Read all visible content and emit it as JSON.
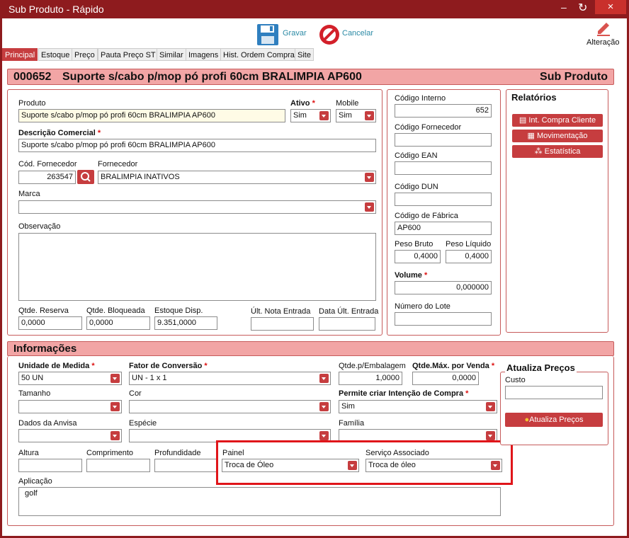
{
  "window": {
    "title": "Sub Produto - Rápido",
    "minimize": "–",
    "refresh": "↻",
    "close": "×"
  },
  "toolbar": {
    "gravar": "Gravar",
    "cancelar": "Cancelar",
    "alteracao": "Alteração"
  },
  "tabs": [
    "Principal",
    "Estoque",
    "Preço",
    "Pauta Preço ST",
    "Similar",
    "Imagens",
    "Hist. Ordem Compra",
    "Site"
  ],
  "header": {
    "code": "000652",
    "name": "Suporte s/cabo p/mop pó profi 60cm BRALIMPIA AP600",
    "type": "Sub Produto"
  },
  "produto": {
    "label": "Produto",
    "value": "Suporte s/cabo p/mop pó profi 60cm BRALIMPIA AP600"
  },
  "ativo": {
    "label": "Ativo",
    "value": "Sim"
  },
  "mobile": {
    "label": "Mobile",
    "value": "Sim"
  },
  "descricao": {
    "label": "Descrição Comercial",
    "value": "Suporte s/cabo p/mop pó profi 60cm BRALIMPIA AP600"
  },
  "cod_fornecedor": {
    "label": "Cód. Fornecedor",
    "value": "263547"
  },
  "fornecedor": {
    "label": "Fornecedor",
    "value": "BRALIMPIA INATIVOS"
  },
  "marca": {
    "label": "Marca",
    "value": ""
  },
  "observacao": {
    "label": "Observação",
    "value": ""
  },
  "qtde_reserva": {
    "label": "Qtde. Reserva",
    "value": "0,0000"
  },
  "qtde_bloqueada": {
    "label": "Qtde. Bloqueada",
    "value": "0,0000"
  },
  "estoque_disp": {
    "label": "Estoque Disp.",
    "value": "9.351,0000"
  },
  "ult_nota": {
    "label": "Últ. Nota Entrada",
    "value": ""
  },
  "data_ult": {
    "label": "Data Últ. Entrada",
    "value": ""
  },
  "codigo_interno": {
    "label": "Código Interno",
    "value": "652"
  },
  "codigo_fornecedor": {
    "label": "Código Fornecedor",
    "value": ""
  },
  "codigo_ean": {
    "label": "Código EAN",
    "value": ""
  },
  "codigo_dun": {
    "label": "Código DUN",
    "value": ""
  },
  "codigo_fabrica": {
    "label": "Código de Fábrica",
    "value": "AP600"
  },
  "peso_bruto": {
    "label": "Peso Bruto",
    "value": "0,4000"
  },
  "peso_liquido": {
    "label": "Peso Líquido",
    "value": "0,4000"
  },
  "volume": {
    "label": "Volume",
    "value": "0,000000"
  },
  "numero_lote": {
    "label": "Número do Lote",
    "value": ""
  },
  "relatorios": {
    "title": "Relatórios",
    "buttons": [
      "Int. Compra Cliente",
      "Movimentação",
      "Estatística"
    ]
  },
  "informacoes": {
    "title": "Informações"
  },
  "unidade_medida": {
    "label": "Unidade de Medida",
    "value": "50 UN"
  },
  "fator_conversao": {
    "label": "Fator de Conversão",
    "value": "UN - 1 x 1"
  },
  "qtde_embalagem": {
    "label": "Qtde.p/Embalagem",
    "value": "1,0000"
  },
  "qtde_max_venda": {
    "label": "Qtde.Máx. por Venda",
    "value": "0,0000"
  },
  "tamanho": {
    "label": "Tamanho",
    "value": ""
  },
  "cor": {
    "label": "Cor",
    "value": ""
  },
  "permite_intencao": {
    "label": "Permite criar Intenção de Compra",
    "value": "Sim"
  },
  "dados_anvisa": {
    "label": "Dados da Anvisa",
    "value": ""
  },
  "especie": {
    "label": "Espécie",
    "value": ""
  },
  "familia": {
    "label": "Família",
    "value": ""
  },
  "altura": {
    "label": "Altura",
    "value": ""
  },
  "comprimento": {
    "label": "Comprimento",
    "value": ""
  },
  "profundidade": {
    "label": "Profundidade",
    "value": ""
  },
  "painel": {
    "label": "Painel",
    "value": "Troca de Óleo"
  },
  "servico_associado": {
    "label": "Serviço Associado",
    "value": "Troca de óleo"
  },
  "aplicacao": {
    "label": "Aplicação",
    "value": "golf"
  },
  "atualiza_precos": {
    "title": "Atualiza Preços",
    "custo_label": "Custo",
    "custo_value": "",
    "button": "Atualiza Preços"
  },
  "colors": {
    "title_bar": "#8e1b1e",
    "accent": "#c63d3f",
    "band": "#f2a5a5",
    "highlight": "#e0151a"
  }
}
